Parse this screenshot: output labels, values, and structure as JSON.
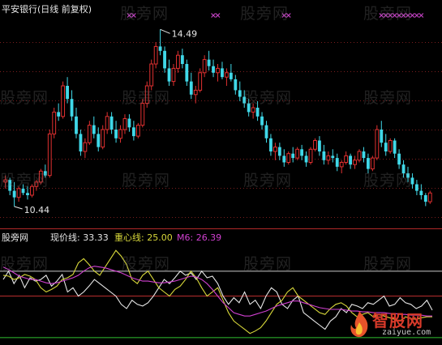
{
  "header": {
    "title": "平安银行(日线 前复权)"
  },
  "watermarks": [
    "股旁网",
    "股旁网",
    "股旁网",
    "股旁网",
    "股旁网",
    "股旁网",
    "股旁网",
    "股旁网",
    "股旁网",
    "股旁网",
    "股旁网",
    "股旁网"
  ],
  "indicator": {
    "name": "股旁网",
    "legend": [
      {
        "label": "现价线: 33.33",
        "color": "#e6e6e6"
      },
      {
        "label": "重心线: 25.00",
        "color": "#d8d83a"
      },
      {
        "label": "M6: 26.39",
        "color": "#d040d0"
      }
    ]
  },
  "logo": {
    "main": "智股网",
    "sub": "zaiyue.com"
  },
  "colors": {
    "up": "#e03030",
    "down": "#40d8e8",
    "white_line": "#e6e6e6",
    "yellow_line": "#d8d83a",
    "magenta_line": "#d040d0",
    "cross": "#c040c0"
  },
  "chart_data": [
    {
      "type": "candlestick",
      "title": "平安银行(日线 前复权)",
      "annotations": [
        {
          "text": "14.49",
          "kind": "high"
        },
        {
          "text": "10.44",
          "kind": "low"
        }
      ],
      "ylim": [
        10.2,
        14.7
      ],
      "ohlc": [
        [
          11.0,
          11.15,
          10.85,
          11.05
        ],
        [
          11.05,
          11.1,
          10.7,
          10.8
        ],
        [
          10.8,
          11.0,
          10.44,
          10.65
        ],
        [
          10.65,
          10.9,
          10.55,
          10.85
        ],
        [
          10.85,
          10.95,
          10.7,
          10.75
        ],
        [
          10.75,
          10.9,
          10.6,
          10.7
        ],
        [
          10.7,
          10.95,
          10.65,
          10.9
        ],
        [
          10.9,
          11.05,
          10.8,
          11.0
        ],
        [
          11.0,
          11.3,
          10.95,
          11.25
        ],
        [
          11.25,
          11.4,
          11.1,
          11.15
        ],
        [
          11.15,
          12.2,
          11.1,
          12.1
        ],
        [
          12.1,
          12.7,
          12.0,
          12.6
        ],
        [
          12.6,
          12.8,
          12.4,
          12.5
        ],
        [
          12.5,
          13.3,
          12.45,
          13.2
        ],
        [
          13.2,
          13.4,
          12.8,
          12.9
        ],
        [
          12.9,
          13.1,
          12.4,
          12.5
        ],
        [
          12.5,
          12.7,
          12.0,
          12.1
        ],
        [
          12.1,
          12.2,
          11.6,
          11.7
        ],
        [
          11.7,
          12.0,
          11.55,
          11.9
        ],
        [
          11.9,
          12.4,
          11.85,
          12.3
        ],
        [
          12.3,
          12.5,
          12.0,
          12.1
        ],
        [
          12.1,
          12.25,
          11.7,
          11.8
        ],
        [
          11.8,
          12.3,
          11.75,
          12.2
        ],
        [
          12.2,
          12.6,
          12.1,
          12.5
        ],
        [
          12.5,
          12.6,
          12.1,
          12.2
        ],
        [
          12.2,
          12.4,
          11.9,
          12.0
        ],
        [
          12.0,
          12.3,
          11.9,
          12.2
        ],
        [
          12.2,
          12.55,
          12.1,
          12.45
        ],
        [
          12.45,
          12.55,
          12.15,
          12.25
        ],
        [
          12.25,
          12.4,
          11.95,
          12.05
        ],
        [
          12.05,
          12.35,
          12.0,
          12.3
        ],
        [
          12.3,
          12.9,
          12.25,
          12.8
        ],
        [
          12.8,
          13.3,
          12.7,
          13.2
        ],
        [
          13.2,
          13.8,
          13.1,
          13.7
        ],
        [
          13.7,
          14.2,
          13.6,
          14.1
        ],
        [
          14.1,
          14.49,
          13.9,
          14.0
        ],
        [
          14.0,
          14.1,
          13.5,
          13.6
        ],
        [
          13.6,
          13.8,
          13.2,
          13.3
        ],
        [
          13.3,
          13.7,
          13.2,
          13.6
        ],
        [
          13.6,
          14.0,
          13.5,
          13.9
        ],
        [
          13.9,
          14.05,
          13.6,
          13.7
        ],
        [
          13.7,
          13.8,
          13.2,
          13.3
        ],
        [
          13.3,
          13.5,
          12.9,
          13.0
        ],
        [
          13.0,
          13.2,
          12.8,
          13.1
        ],
        [
          13.1,
          13.6,
          13.05,
          13.5
        ],
        [
          13.5,
          13.9,
          13.4,
          13.8
        ],
        [
          13.8,
          14.0,
          13.55,
          13.65
        ],
        [
          13.65,
          13.8,
          13.4,
          13.5
        ],
        [
          13.5,
          13.7,
          13.3,
          13.6
        ],
        [
          13.6,
          13.75,
          13.35,
          13.4
        ],
        [
          13.4,
          13.6,
          13.2,
          13.5
        ],
        [
          13.5,
          13.7,
          13.3,
          13.35
        ],
        [
          13.35,
          13.45,
          13.0,
          13.1
        ],
        [
          13.1,
          13.3,
          12.85,
          12.95
        ],
        [
          12.95,
          13.1,
          12.7,
          12.8
        ],
        [
          12.8,
          12.9,
          12.5,
          12.6
        ],
        [
          12.6,
          12.8,
          12.45,
          12.7
        ],
        [
          12.7,
          12.85,
          12.4,
          12.5
        ],
        [
          12.5,
          12.6,
          12.2,
          12.3
        ],
        [
          12.3,
          12.4,
          11.9,
          12.0
        ],
        [
          12.0,
          12.1,
          11.6,
          11.7
        ],
        [
          11.7,
          11.9,
          11.5,
          11.8
        ],
        [
          11.8,
          11.9,
          11.5,
          11.6
        ],
        [
          11.6,
          11.75,
          11.35,
          11.45
        ],
        [
          11.45,
          11.7,
          11.4,
          11.65
        ],
        [
          11.65,
          11.8,
          11.45,
          11.55
        ],
        [
          11.55,
          11.8,
          11.5,
          11.75
        ],
        [
          11.75,
          11.85,
          11.5,
          11.6
        ],
        [
          11.6,
          11.7,
          11.35,
          11.45
        ],
        [
          11.45,
          11.8,
          11.4,
          11.75
        ],
        [
          11.75,
          12.0,
          11.7,
          11.95
        ],
        [
          11.95,
          12.05,
          11.6,
          11.7
        ],
        [
          11.7,
          11.85,
          11.4,
          11.5
        ],
        [
          11.5,
          11.7,
          11.4,
          11.6
        ],
        [
          11.6,
          11.75,
          11.45,
          11.55
        ],
        [
          11.55,
          11.65,
          11.25,
          11.35
        ],
        [
          11.35,
          11.5,
          11.2,
          11.45
        ],
        [
          11.45,
          11.7,
          11.4,
          11.6
        ],
        [
          11.6,
          11.65,
          11.3,
          11.4
        ],
        [
          11.4,
          11.6,
          11.3,
          11.5
        ],
        [
          11.5,
          11.75,
          11.45,
          11.7
        ],
        [
          11.7,
          11.8,
          11.45,
          11.55
        ],
        [
          11.55,
          11.65,
          11.2,
          11.3
        ],
        [
          11.3,
          11.6,
          11.25,
          11.55
        ],
        [
          11.55,
          12.3,
          11.5,
          12.2
        ],
        [
          12.2,
          12.4,
          11.8,
          11.9
        ],
        [
          11.9,
          12.1,
          11.6,
          11.7
        ],
        [
          11.7,
          12.0,
          11.65,
          11.95
        ],
        [
          11.95,
          12.0,
          11.55,
          11.65
        ],
        [
          11.65,
          11.75,
          11.3,
          11.4
        ],
        [
          11.4,
          11.5,
          11.1,
          11.2
        ],
        [
          11.2,
          11.35,
          11.0,
          11.1
        ],
        [
          11.1,
          11.2,
          10.85,
          10.95
        ],
        [
          10.95,
          11.05,
          10.7,
          10.8
        ],
        [
          10.8,
          10.95,
          10.6,
          10.7
        ],
        [
          10.7,
          10.75,
          10.45,
          10.55
        ],
        [
          10.55,
          10.8,
          10.5,
          10.75
        ]
      ]
    },
    {
      "type": "line",
      "title": "股旁网",
      "ylim": [
        -5,
        112
      ],
      "series": [
        {
          "name": "现价线",
          "color": "#e6e6e6",
          "values": [
            70,
            80,
            65,
            75,
            60,
            72,
            68,
            70,
            75,
            62,
            68,
            76,
            55,
            60,
            50,
            55,
            62,
            70,
            65,
            60,
            55,
            50,
            40,
            35,
            45,
            40,
            38,
            42,
            50,
            60,
            70,
            65,
            72,
            80,
            75,
            78,
            70,
            80,
            72,
            74,
            65,
            50,
            40,
            48,
            42,
            55,
            40,
            45,
            35,
            50,
            60,
            55,
            40,
            35,
            45,
            50,
            30,
            25,
            20,
            15,
            10,
            20,
            25,
            35,
            30,
            40,
            38,
            35,
            42,
            40,
            45,
            50,
            38,
            40,
            48,
            42,
            40,
            35,
            38,
            45,
            33
          ]
        },
        {
          "name": "重心线",
          "color": "#d8d83a",
          "values": [
            75,
            74,
            70,
            72,
            76,
            74,
            70,
            60,
            55,
            58,
            62,
            70,
            72,
            76,
            90,
            95,
            88,
            80,
            75,
            85,
            95,
            105,
            98,
            88,
            70,
            65,
            75,
            80,
            70,
            60,
            55,
            50,
            58,
            62,
            70,
            80,
            72,
            60,
            50,
            55,
            60,
            45,
            30,
            20,
            15,
            10,
            5,
            8,
            12,
            20,
            30,
            40,
            45,
            55,
            60,
            50,
            45,
            40,
            35,
            30,
            28,
            35,
            40,
            42,
            38,
            30,
            25,
            28,
            30,
            25,
            28,
            26,
            24,
            22,
            20,
            25,
            23,
            22,
            24,
            25,
            25
          ]
        },
        {
          "name": "M6",
          "color": "#d040d0",
          "values": [
            85,
            82,
            78,
            74,
            72,
            70,
            70,
            68,
            66,
            65,
            66,
            68,
            70,
            72,
            75,
            80,
            84,
            86,
            85,
            84,
            82,
            80,
            78,
            75,
            72,
            70,
            68,
            68,
            67,
            66,
            66,
            67,
            68,
            70,
            72,
            74,
            73,
            70,
            65,
            58,
            50,
            42,
            36,
            30,
            28,
            26,
            26,
            28,
            30,
            32,
            35,
            38,
            40,
            42,
            44,
            44,
            42,
            40,
            38,
            36,
            35,
            34,
            34,
            34,
            33,
            32,
            32,
            31,
            31,
            30,
            30,
            30,
            29,
            29,
            28,
            28,
            27,
            27,
            27,
            26,
            26
          ]
        }
      ]
    }
  ]
}
